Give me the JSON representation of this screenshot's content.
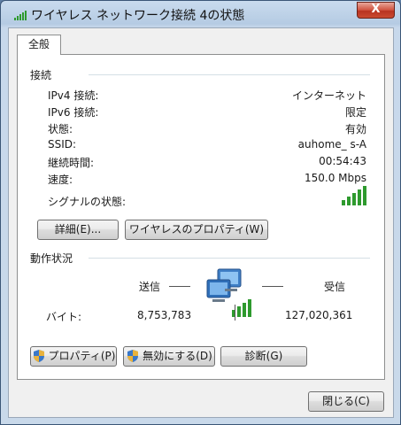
{
  "window": {
    "title": "ワイヤレス ネットワーク接続 4の状態",
    "close_label": "X"
  },
  "tabs": [
    {
      "label": "全般"
    }
  ],
  "connection": {
    "section_title": "接続",
    "rows": [
      {
        "label": "IPv4 接続:",
        "value": "インターネット"
      },
      {
        "label": "IPv6 接続:",
        "value": "限定"
      },
      {
        "label": "状態:",
        "value": "有効"
      },
      {
        "label": "SSID:",
        "value": "auhome_      s-A"
      },
      {
        "label": "継続時間:",
        "value": "00:54:43"
      },
      {
        "label": "速度:",
        "value": "150.0 Mbps"
      }
    ],
    "signal_label": "シグナルの状態:",
    "signal_bars": 5,
    "details_button": "詳細(E)...",
    "wireless_properties_button": "ワイヤレスのプロパティ(W)"
  },
  "activity": {
    "section_title": "動作状況",
    "sent_label": "送信",
    "received_label": "受信",
    "bytes_label": "バイト:",
    "bytes_sent": "8,753,783",
    "bytes_received": "127,020,361",
    "properties_button": "プロパティ(P)",
    "disable_button": "無効にする(D)",
    "diagnose_button": "診断(G)"
  },
  "footer": {
    "close_button": "閉じる(C)"
  },
  "colors": {
    "signal_green": "#2e9a2e",
    "title_bar": "#b5cbe3",
    "close_red": "#c94a30"
  },
  "icons": [
    "wireless-signal-icon",
    "close-x-icon",
    "network-computers-icon",
    "shield-icon"
  ]
}
